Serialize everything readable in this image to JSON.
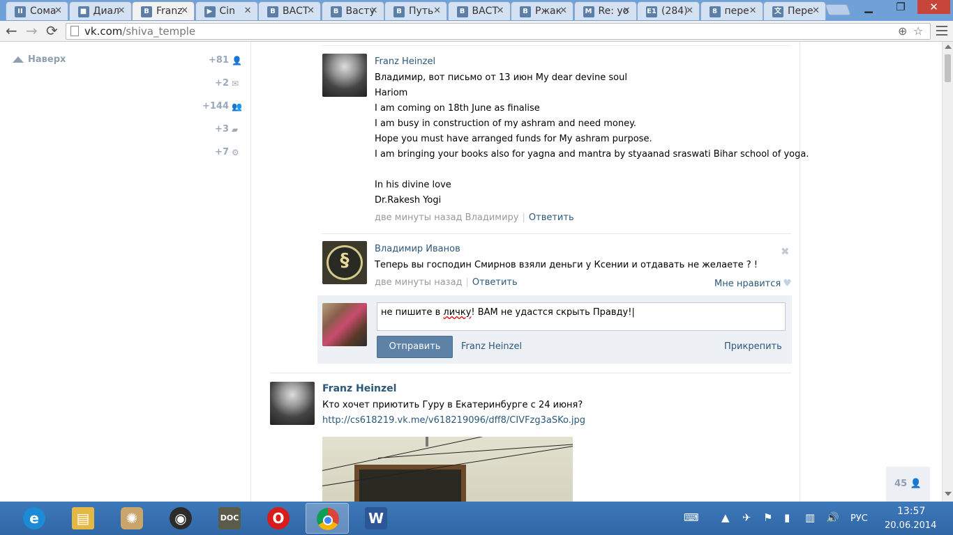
{
  "browser": {
    "tabs": [
      {
        "label": "Сома",
        "fav": "II"
      },
      {
        "label": "Диал",
        "fav": "■"
      },
      {
        "label": "Franz",
        "fav": "В"
      },
      {
        "label": "Cin",
        "fav": "▶"
      },
      {
        "label": "ВАСТ",
        "fav": "В"
      },
      {
        "label": "Васту",
        "fav": "В"
      },
      {
        "label": "Путь",
        "fav": "В"
      },
      {
        "label": "ВАСТ",
        "fav": "В"
      },
      {
        "label": "Ржак",
        "fav": "В"
      },
      {
        "label": "Re: yo",
        "fav": "M"
      },
      {
        "label": "(284)",
        "fav": "E1"
      },
      {
        "label": "пере",
        "fav": "8"
      },
      {
        "label": "Пере",
        "fav": "文"
      }
    ],
    "url_host": "vk.com",
    "url_path": "/shiva_temple"
  },
  "left_panel": {
    "back_to_top": "Наверх",
    "counters": [
      {
        "value": "+81",
        "icon": "user-icon"
      },
      {
        "value": "+2",
        "icon": "envelope-icon"
      },
      {
        "value": "+144",
        "icon": "friends-icon"
      },
      {
        "value": "+3",
        "icon": "comment-icon"
      },
      {
        "value": "+7",
        "icon": "gear-icon"
      }
    ]
  },
  "comment1": {
    "author": "Franz Heinzel",
    "lines": [
      "Владимир, вот письмо от 13 июн My dear devine soul",
      "Hariom",
      "I am coming on 18th June as finalise",
      "I am busy in construction of my ashram and need money.",
      "Hope you must have arranged funds for My ashram purpose.",
      "I am bringing your books also for yagna and mantra by styaanad sraswati Bihar school of yoga.",
      "",
      "In his divine love",
      "Dr.Rakesh Yogi"
    ],
    "time": "две минуты назад Владимиру",
    "reply": "Ответить"
  },
  "comment2": {
    "author": "Владимир Иванов",
    "text": "Теперь вы господин Смирнов взяли деньги у Ксении и отдавать не желаете ? !",
    "time": "две минуты назад",
    "reply": "Ответить",
    "like": "Мне нравится"
  },
  "reply_box": {
    "text_before": "не пишите в ",
    "misspelled": "личку",
    "text_after": "! ВАМ не удастся скрыть Правду!",
    "send": "Отправить",
    "to": "Franz Heinzel",
    "attach": "Прикрепить"
  },
  "post": {
    "author": "Franz Heinzel",
    "text": "Кто хочет приютить Гуру в Екатеринбурге с 24 июня?",
    "link": "http://cs618219.vk.me/v618219096/dff8/CIVFzg3aSKo.jpg"
  },
  "online_count": "45",
  "taskbar": {
    "apps": [
      "ie-icon",
      "explorer-icon",
      "app-icon",
      "audio-icon",
      "doc-icon",
      "opera-icon",
      "chrome-icon",
      "word-icon"
    ],
    "lang": "РУС",
    "time": "13:57",
    "date": "20.06.2014"
  }
}
